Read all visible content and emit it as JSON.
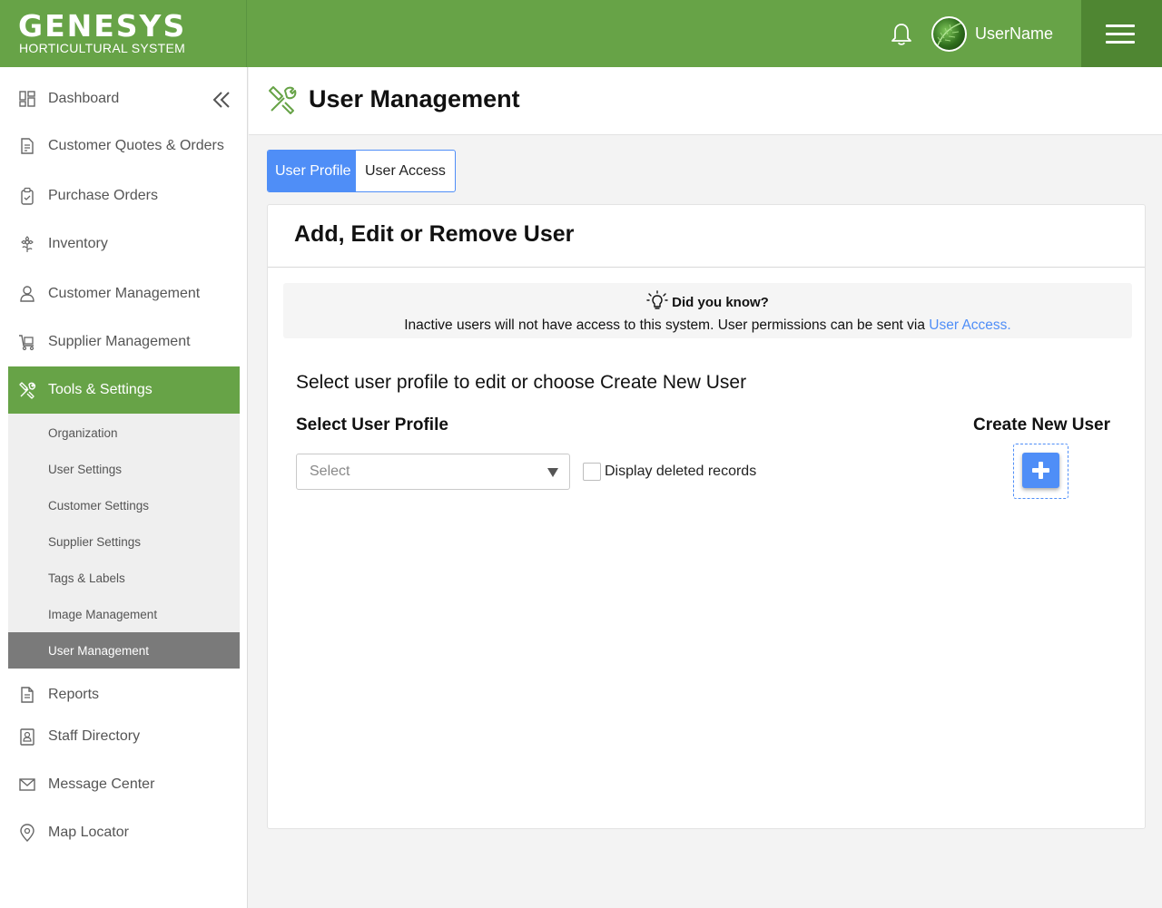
{
  "brand": {
    "name": "GENESYS",
    "subtitle": "HORTICULTURAL SYSTEM",
    "primary_color": "#67a347",
    "accent_color": "#4f8ef7"
  },
  "header": {
    "notification_icon": "bell-icon",
    "username": "UserName",
    "menu_icon": "hamburger-icon"
  },
  "sidebar": {
    "items": [
      {
        "label": "Dashboard",
        "icon": "dashboard-icon"
      },
      {
        "label": "Customer Quotes & Orders",
        "icon": "document-icon"
      },
      {
        "label": "Purchase Orders",
        "icon": "clipboard-icon"
      },
      {
        "label": "Inventory",
        "icon": "plant-icon"
      },
      {
        "label": "Customer Management",
        "icon": "user-icon"
      },
      {
        "label": "Supplier Management",
        "icon": "cart-icon"
      },
      {
        "label": "Tools & Settings",
        "icon": "tools-icon",
        "active": true
      },
      {
        "label": "Reports",
        "icon": "report-icon"
      },
      {
        "label": "Staff Directory",
        "icon": "contact-icon"
      },
      {
        "label": "Message Center",
        "icon": "mail-icon"
      },
      {
        "label": "Map Locator",
        "icon": "map-pin-icon"
      }
    ],
    "sub_items": [
      {
        "label": "Organization"
      },
      {
        "label": "User Settings"
      },
      {
        "label": "Customer Settings"
      },
      {
        "label": "Supplier Settings"
      },
      {
        "label": "Tags & Labels"
      },
      {
        "label": "Image Management"
      },
      {
        "label": "User Management",
        "active": true
      }
    ]
  },
  "page": {
    "title": "User Management",
    "tabs": [
      {
        "label": "User Profile",
        "active": true
      },
      {
        "label": "User Access",
        "active": false
      }
    ]
  },
  "card": {
    "title": "Add, Edit or Remove User",
    "tip_title": "Did you know?",
    "tip_text": "Inactive users will not have access to this system. User permissions can be sent via ",
    "tip_link": "User Access.",
    "instruction": "Select user profile to edit or choose Create New User",
    "select_label": "Select User Profile",
    "select_value": "Select",
    "checkbox_label": "Display deleted records",
    "checkbox_checked": false,
    "create_label": "Create New User"
  }
}
